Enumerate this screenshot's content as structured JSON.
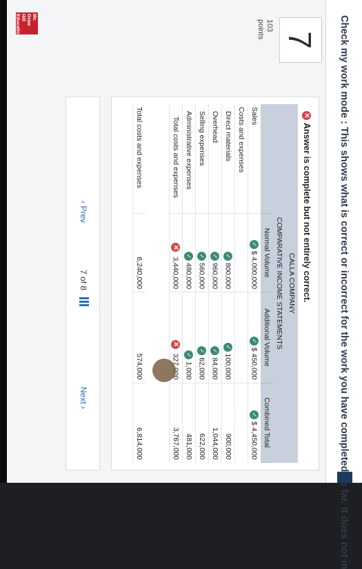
{
  "banner": {
    "text": "Check my work mode : This shows what is correct or incorrect for the work you have completed so far. It does not in"
  },
  "question": {
    "number": "7",
    "points": "103",
    "points_label": "points"
  },
  "answer_status": "Answer is complete but not entirely correct.",
  "statement": {
    "company": "CALLA COMPANY",
    "title": "COMPARATIVE INCOME STATEMENTS",
    "columns": [
      "",
      "Normal Volume",
      "Additional Volume",
      "Combined Total"
    ],
    "rows": [
      {
        "label": "Sales",
        "normal": "$  4,000,000",
        "additional": "$  450,000",
        "combined": "$  4,450,000"
      },
      {
        "label": "Costs and expenses",
        "normal": "",
        "additional": "",
        "combined": ""
      },
      {
        "label": "Direct materials",
        "normal": "800,000",
        "additional": "100,000",
        "combined": "900,000"
      },
      {
        "label": "Overhead",
        "normal": "960,000",
        "additional": "84,000",
        "combined": "1,044,000"
      },
      {
        "label": "Selling expenses",
        "normal": "560,000",
        "additional": "62,000",
        "combined": "622,000"
      },
      {
        "label": "Administrative expenses",
        "normal": "480,000",
        "additional": "1,000",
        "combined": "481,000"
      },
      {
        "label": "Total costs and expenses",
        "normal": "3,440,000",
        "additional": "327,000",
        "combined": "3,767,000"
      }
    ],
    "footer_row": {
      "label": "Total costs and expenses",
      "normal": "6,240,000",
      "additional": "574,000",
      "combined": "6,814,000"
    }
  },
  "nav": {
    "prev": "Prev",
    "pager": "7 of 8",
    "next": "Next"
  },
  "logo": {
    "text": "Mc Graw Hill Education"
  },
  "colors": {
    "correct": "#3c8a7a",
    "incorrect": "#d9434a",
    "header_bg": "#c7d0dc"
  }
}
